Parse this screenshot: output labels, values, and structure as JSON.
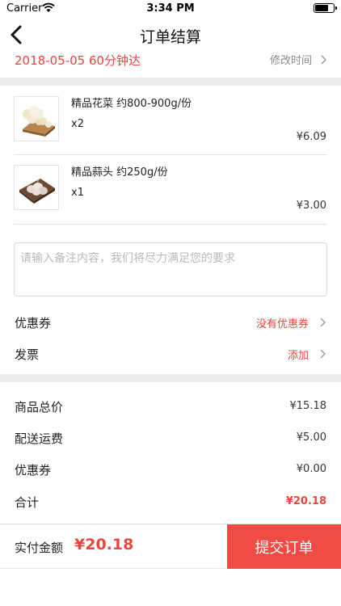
{
  "status_bar": {
    "carrier": "Carrier",
    "time": "3:34 PM"
  },
  "nav": {
    "title": "订单结算",
    "back_icon": "chevron-left-icon"
  },
  "delivery": {
    "time": "2018-05-05 60分钟达",
    "change_label": "修改时间"
  },
  "products": [
    {
      "name": "精品花菜 约800-900g/份",
      "qty": "x2",
      "price": "¥6.09",
      "image": "cauliflower"
    },
    {
      "name": "精品蒜头 约250g/份",
      "qty": "x1",
      "price": "¥3.00",
      "image": "garlic"
    }
  ],
  "remark": {
    "placeholder": "请输入备注内容，我们将尽力满足您的要求"
  },
  "options": {
    "coupon": {
      "label": "优惠券",
      "value": "没有优惠券"
    },
    "invoice": {
      "label": "发票",
      "value": "添加"
    }
  },
  "summary": {
    "goods_total": {
      "label": "商品总价",
      "value": "¥15.18"
    },
    "shipping": {
      "label": "配送运费",
      "value": "¥5.00"
    },
    "coupon": {
      "label": "优惠券",
      "value": "¥0.00"
    },
    "total": {
      "label": "合计",
      "value": "¥20.18"
    }
  },
  "bottom": {
    "pay_label": "实付金额",
    "pay_amount": "¥20.18",
    "submit_label": "提交订单"
  },
  "colors": {
    "accent": "#e8463e",
    "button": "#f04b45",
    "divider": "#ececec"
  }
}
